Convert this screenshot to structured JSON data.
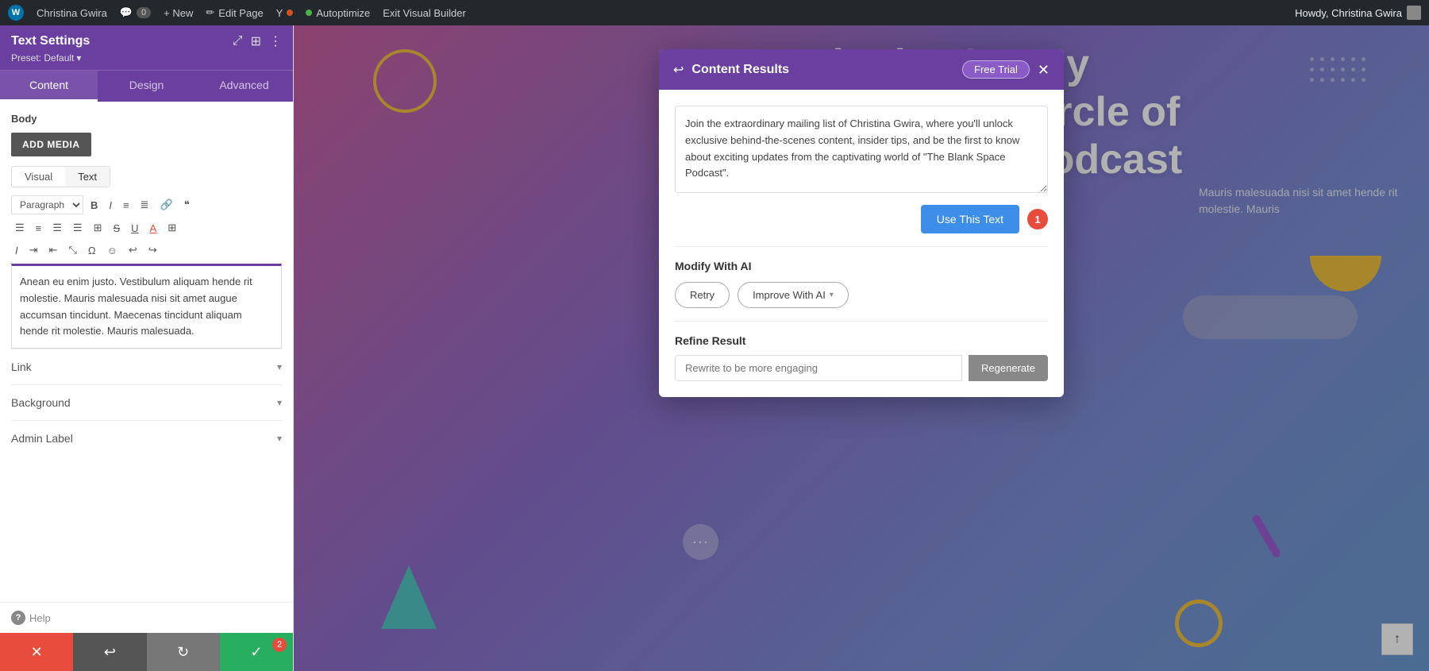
{
  "adminBar": {
    "wpLabel": "W",
    "siteName": "Christina Gwira",
    "commentCount": "0",
    "newLabel": "+ New",
    "editPageLabel": "Edit Page",
    "yoastLabel": "Y",
    "autoptimizeLabel": "Autoptimize",
    "exitBuilderLabel": "Exit Visual Builder",
    "howdyLabel": "Howdy, Christina Gwira"
  },
  "leftPanel": {
    "title": "Text Settings",
    "presetLabel": "Preset: Default",
    "tabs": [
      "Content",
      "Design",
      "Advanced"
    ],
    "activeTab": "Content",
    "sectionLabel": "Body",
    "addMediaLabel": "ADD MEDIA",
    "textModeTabs": [
      "Visual",
      "Text"
    ],
    "activeTextMode": "Visual",
    "paragraphSelect": "Paragraph",
    "contentText": "Anean eu enim justo. Vestibulum aliquam hende rit molestie. Mauris malesuada nisi sit amet augue accumsan tincidunt. Maecenas tincidunt aliquam hende rit molestie. Mauris malesuada.",
    "linkLabel": "Link",
    "backgroundLabel": "Background",
    "adminLabelLabel": "Admin Label",
    "helpLabel": "Help",
    "saveBadge": "2"
  },
  "modal": {
    "backIcon": "↩",
    "title": "Content Results",
    "freeTrialLabel": "Free Trial",
    "resultText": "Join the extraordinary mailing list of Christina Gwira, where you'll unlock exclusive behind-the-scenes content, insider tips, and be the first to know about exciting updates from the captivating world of \"The Blank Space Podcast\".",
    "useThisTextLabel": "Use This Text",
    "stepNumber": "1",
    "modifyWithAILabel": "Modify With AI",
    "retryLabel": "Retry",
    "improveWithAILabel": "Improve With AI",
    "refineResultLabel": "Refine Result",
    "refinePlaceholder": "Rewrite to be more engaging",
    "regenerateLabel": "Regenerate"
  },
  "pageBg": {
    "headline1": "Join the Otorgy",
    "headline2": "Hysterical Inner Circle of",
    "headline3": "the Blank Space Podcast",
    "bodyText": "Mauris malesuada nisi sit amet\nhende rit molestie. Mauris"
  },
  "icons": {
    "maximize": "⤢",
    "columns": "⊞",
    "moreVert": "⋮",
    "chevronDown": "▾",
    "bold": "B",
    "italic": "I",
    "unorderedList": "≡",
    "orderedList": "≣",
    "link": "🔗",
    "blockquote": "❝",
    "alignLeft": "⬜",
    "alignCenter": "⬛",
    "alignRight": "⬜",
    "alignJustify": "⬜",
    "table": "⊞",
    "strikethrough": "S",
    "underline": "U",
    "colorA": "A",
    "copy": "⊞",
    "italic2": "I",
    "indent": "⇥",
    "outdent": "⇤",
    "fullscreen": "⤡",
    "specialChar": "Ω",
    "emoji": "☺",
    "undo": "↩",
    "redo": "↪",
    "helpIcon": "?",
    "cancelIcon": "✕",
    "undoIcon": "↩",
    "redoIcon": "↻",
    "saveIcon": "✓",
    "arrowUp": "↑",
    "backIcon": "↩"
  }
}
